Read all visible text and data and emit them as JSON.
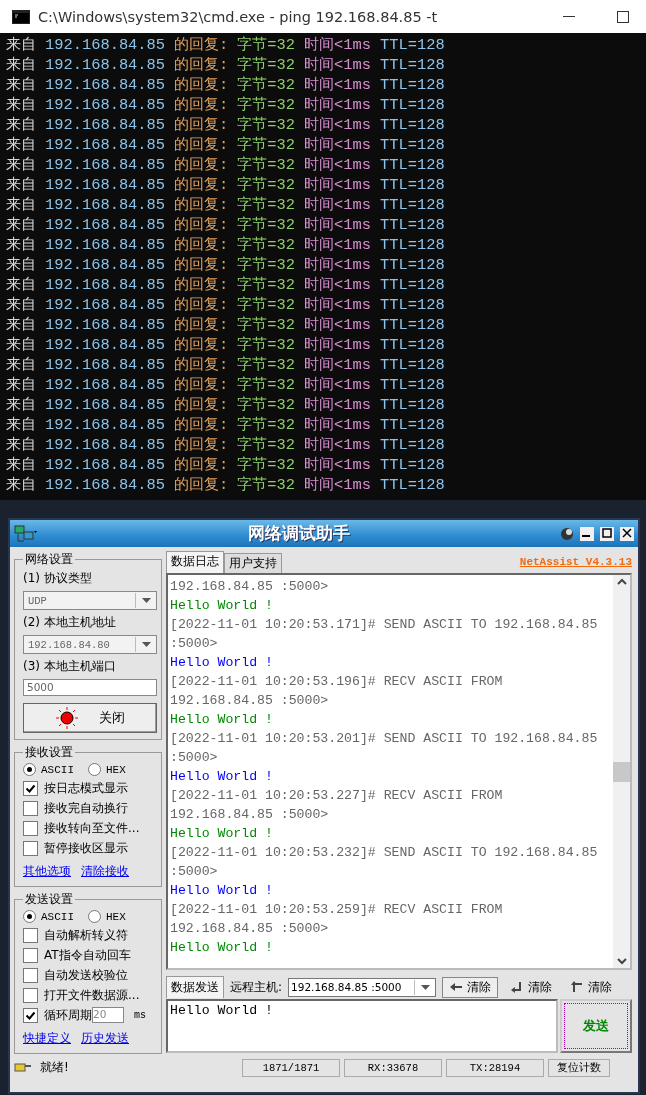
{
  "console": {
    "title": "C:\\Windows\\system32\\cmd.exe - ping  192.168.84.85 -t",
    "segments": [
      {
        "color": "#d8d8d8"
      },
      {
        "color": "#8ec4ea"
      },
      {
        "color": "#e2a25c"
      },
      {
        "color": "#8fd06a"
      },
      {
        "color": "#d890d0"
      },
      {
        "color": "#8ec4ea"
      }
    ],
    "lines": [
      [
        "来自",
        "192.168.84.85",
        "的回复:",
        "字节=32",
        "时间<1ms",
        "TTL=128"
      ],
      [
        "来自",
        "192.168.84.85",
        "的回复:",
        "字节=32",
        "时间<1ms",
        "TTL=128"
      ],
      [
        "来自",
        "192.168.84.85",
        "的回复:",
        "字节=32",
        "时间<1ms",
        "TTL=128"
      ],
      [
        "来自",
        "192.168.84.85",
        "的回复:",
        "字节=32",
        "时间<1ms",
        "TTL=128"
      ],
      [
        "来自",
        "192.168.84.85",
        "的回复:",
        "字节=32",
        "时间<1ms",
        "TTL=128"
      ],
      [
        "来自",
        "192.168.84.85",
        "的回复:",
        "字节=32",
        "时间<1ms",
        "TTL=128"
      ],
      [
        "来自",
        "192.168.84.85",
        "的回复:",
        "字节=32",
        "时间<1ms",
        "TTL=128"
      ],
      [
        "来自",
        "192.168.84.85",
        "的回复:",
        "字节=32",
        "时间<1ms",
        "TTL=128"
      ],
      [
        "来自",
        "192.168.84.85",
        "的回复:",
        "字节=32",
        "时间<1ms",
        "TTL=128"
      ],
      [
        "来自",
        "192.168.84.85",
        "的回复:",
        "字节=32",
        "时间<1ms",
        "TTL=128"
      ],
      [
        "来自",
        "192.168.84.85",
        "的回复:",
        "字节=32",
        "时间<1ms",
        "TTL=128"
      ],
      [
        "来自",
        "192.168.84.85",
        "的回复:",
        "字节=32",
        "时间<1ms",
        "TTL=128"
      ],
      [
        "来自",
        "192.168.84.85",
        "的回复:",
        "字节=32",
        "时间<1ms",
        "TTL=128"
      ],
      [
        "来自",
        "192.168.84.85",
        "的回复:",
        "字节=32",
        "时间<1ms",
        "TTL=128"
      ],
      [
        "来自",
        "192.168.84.85",
        "的回复:",
        "字节=32",
        "时间<1ms",
        "TTL=128"
      ],
      [
        "来自",
        "192.168.84.85",
        "的回复:",
        "字节=32",
        "时间<1ms",
        "TTL=128"
      ],
      [
        "来自",
        "192.168.84.85",
        "的回复:",
        "字节=32",
        "时间<1ms",
        "TTL=128"
      ],
      [
        "来自",
        "192.168.84.85",
        "的回复:",
        "字节=32",
        "时间<1ms",
        "TTL=128"
      ],
      [
        "来自",
        "192.168.84.85",
        "的回复:",
        "字节=32",
        "时间<1ms",
        "TTL=128"
      ],
      [
        "来自",
        "192.168.84.85",
        "的回复:",
        "字节=32",
        "时间<1ms",
        "TTL=128"
      ],
      [
        "来自",
        "192.168.84.85",
        "的回复:",
        "字节=32",
        "时间<1ms",
        "TTL=128"
      ],
      [
        "来自",
        "192.168.84.85",
        "的回复:",
        "字节=32",
        "时间<1ms",
        "TTL=128"
      ],
      [
        "来自",
        "192.168.84.85",
        "的回复:",
        "字节=32",
        "时间<1ms",
        "TTL=128"
      ]
    ]
  },
  "netassist": {
    "title": "网络调试助手",
    "network_settings": {
      "title": "网络设置",
      "protocol_label": "(1) 协议类型",
      "protocol": "UDP",
      "host_label": "(2) 本地主机地址",
      "host": "192.168.84.80",
      "port_label": "(3) 本地主机端口",
      "port": "5000",
      "toggle_button": "关闭"
    },
    "receive_settings": {
      "title": "接收设置",
      "radios": [
        {
          "label": "ASCII",
          "selected": true
        },
        {
          "label": "HEX",
          "selected": false
        }
      ],
      "options": [
        {
          "label": "按日志模式显示",
          "checked": true
        },
        {
          "label": "接收完自动换行",
          "checked": false
        },
        {
          "label": "接收转向至文件...",
          "checked": false
        },
        {
          "label": "暂停接收区显示",
          "checked": false
        }
      ],
      "links": [
        "其他选项",
        "清除接收"
      ]
    },
    "send_settings": {
      "title": "发送设置",
      "radios": [
        {
          "label": "ASCII",
          "selected": true
        },
        {
          "label": "HEX",
          "selected": false
        }
      ],
      "options": [
        {
          "label": "自动解析转义符",
          "checked": false
        },
        {
          "label": "AT指令自动回车",
          "checked": false
        },
        {
          "label": "自动发送校验位",
          "checked": false
        },
        {
          "label": "打开文件数据源...",
          "checked": false
        },
        {
          "label": "循环周期",
          "checked": true,
          "kind": "period",
          "value": "20",
          "unit": "ms"
        }
      ],
      "links": [
        "快捷定义",
        "历史发送"
      ]
    },
    "tabs": [
      {
        "label": "数据日志",
        "selected": true
      },
      {
        "label": "用户支持",
        "selected": false
      }
    ],
    "version": "NetAssist V4.3.13",
    "log": [
      {
        "kind": "meta",
        "text": "192.168.84.85 :5000>"
      },
      {
        "kind": "recv",
        "text": "Hello World !"
      },
      {
        "kind": "meta",
        "text": "[2022-11-01 10:20:53.171]# SEND ASCII TO 192.168.84.85"
      },
      {
        "kind": "meta",
        "text": ":5000>"
      },
      {
        "kind": "sent",
        "text": "Hello World !"
      },
      {
        "kind": "meta",
        "text": "[2022-11-01 10:20:53.196]# RECV ASCII FROM"
      },
      {
        "kind": "meta",
        "text": "192.168.84.85 :5000>"
      },
      {
        "kind": "recv",
        "text": "Hello World !"
      },
      {
        "kind": "meta",
        "text": "[2022-11-01 10:20:53.201]# SEND ASCII TO 192.168.84.85"
      },
      {
        "kind": "meta",
        "text": ":5000>"
      },
      {
        "kind": "sent",
        "text": "Hello World !"
      },
      {
        "kind": "meta",
        "text": "[2022-11-01 10:20:53.227]# RECV ASCII FROM"
      },
      {
        "kind": "meta",
        "text": "192.168.84.85 :5000>"
      },
      {
        "kind": "recv",
        "text": "Hello World !"
      },
      {
        "kind": "meta",
        "text": "[2022-11-01 10:20:53.232]# SEND ASCII TO 192.168.84.85"
      },
      {
        "kind": "meta",
        "text": ":5000>"
      },
      {
        "kind": "sent",
        "text": "Hello World !"
      },
      {
        "kind": "meta",
        "text": "[2022-11-01 10:20:53.259]# RECV ASCII FROM"
      },
      {
        "kind": "meta",
        "text": "192.168.84.85 :5000>"
      },
      {
        "kind": "recv",
        "text": "Hello World !"
      }
    ],
    "send_bar": {
      "tab": "数据发送",
      "remote_label": "远程主机:",
      "remote": "192.168.84.85 :5000",
      "clear_buttons": [
        "清除",
        "清除",
        "清除"
      ]
    },
    "message": "Hello World !",
    "send_button": "发送",
    "status": {
      "text": "就绪!",
      "counts": "1871/1871",
      "rx": "RX:33678",
      "tx": "TX:28194",
      "reset": "复位计数"
    }
  }
}
